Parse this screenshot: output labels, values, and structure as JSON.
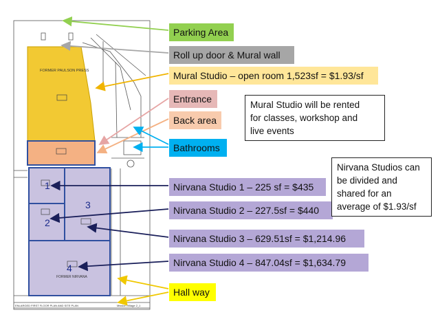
{
  "colors": {
    "parking": "#92d050",
    "rollup": "#a6a6a6",
    "mural": "#ffe699",
    "entrance": "#e6b8b7",
    "back": "#f8cbad",
    "bathrooms": "#00b0f0",
    "studio": "#b4a7d6",
    "hallway": "#ffff00",
    "mural_fill": "#f0c419",
    "back_fill": "#f4b183",
    "studio_fill": "#c9c2e0",
    "studio_border": "#2f4f9f"
  },
  "labels": {
    "parking": "Parking Area",
    "rollup": "Roll up door & Mural wall",
    "mural": "Mural Studio – open room 1,523sf = $1.93/sf",
    "entrance": "Entrance",
    "back": "Back area",
    "bathrooms": "Bathrooms",
    "studio1": "Nirvana Studio 1 – 225 sf = $435",
    "studio2": "Nirvana Studio 2 – 227.5sf = $440",
    "studio3": "Nirvana Studio 3 – 629.51sf = $1,214.96",
    "studio4": "Nirvana Studio 4 – 847.04sf = $1,634.79",
    "hallway": "Hall way"
  },
  "notes": {
    "mural": [
      "Mural Studio will be rented",
      "for classes, workshop and",
      "live events"
    ],
    "nirvana": [
      "Nirvana Studios can",
      "be divided and",
      "shared for an",
      "average of $1.93/sf"
    ]
  },
  "plan": {
    "room_numbers": [
      "1",
      "2",
      "3",
      "4"
    ],
    "former_paulson": "FORMER PAULSON PRESS",
    "former_nirvana": "FORMER NIRVANA",
    "title_block": "ENLARGED FIRST FLOOR PLAN AND SITE PLAN",
    "sheet_title": "Mission Village 2_1"
  },
  "icons": [
    "arrow-icon"
  ]
}
